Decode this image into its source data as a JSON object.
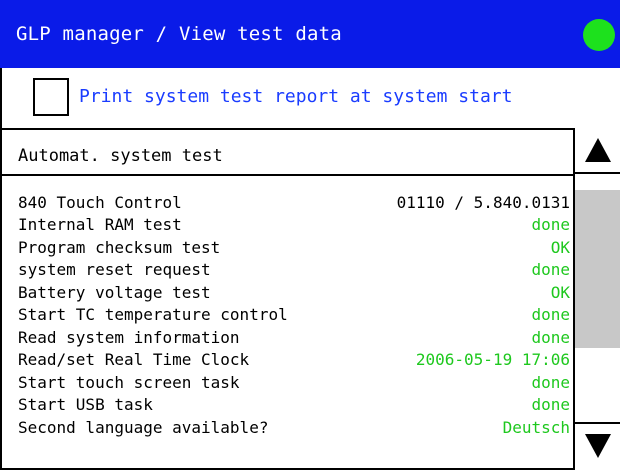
{
  "header": {
    "title": "GLP manager / View test data",
    "status_color": "#1de11d"
  },
  "print_option": {
    "label": "Print system test report at system start",
    "checked": false
  },
  "section": {
    "title": "Automat. system test"
  },
  "tests": [
    {
      "name": "840 Touch Control",
      "value": "01110 / 5.840.0131"
    },
    {
      "name": "Internal RAM test",
      "value": "done"
    },
    {
      "name": "Program checksum test",
      "value": "OK"
    },
    {
      "name": "system reset request",
      "value": "done"
    },
    {
      "name": "Battery voltage test",
      "value": "OK"
    },
    {
      "name": "Start TC temperature control",
      "value": "done"
    },
    {
      "name": "Read system information",
      "value": "done"
    },
    {
      "name": "Read/set Real Time Clock",
      "value": "2006-05-19 17:06"
    },
    {
      "name": "Start touch screen task",
      "value": "done"
    },
    {
      "name": "Start USB task",
      "value": "done"
    },
    {
      "name": "Second language available?",
      "value": "Deutsch"
    }
  ],
  "colors": {
    "title_bar": "#0a1be8",
    "link_text": "#1a3cff",
    "status_ok_text": "#1ec81e"
  },
  "icons": {
    "scroll_up": "triangle-up-icon",
    "scroll_down": "triangle-down-icon"
  }
}
